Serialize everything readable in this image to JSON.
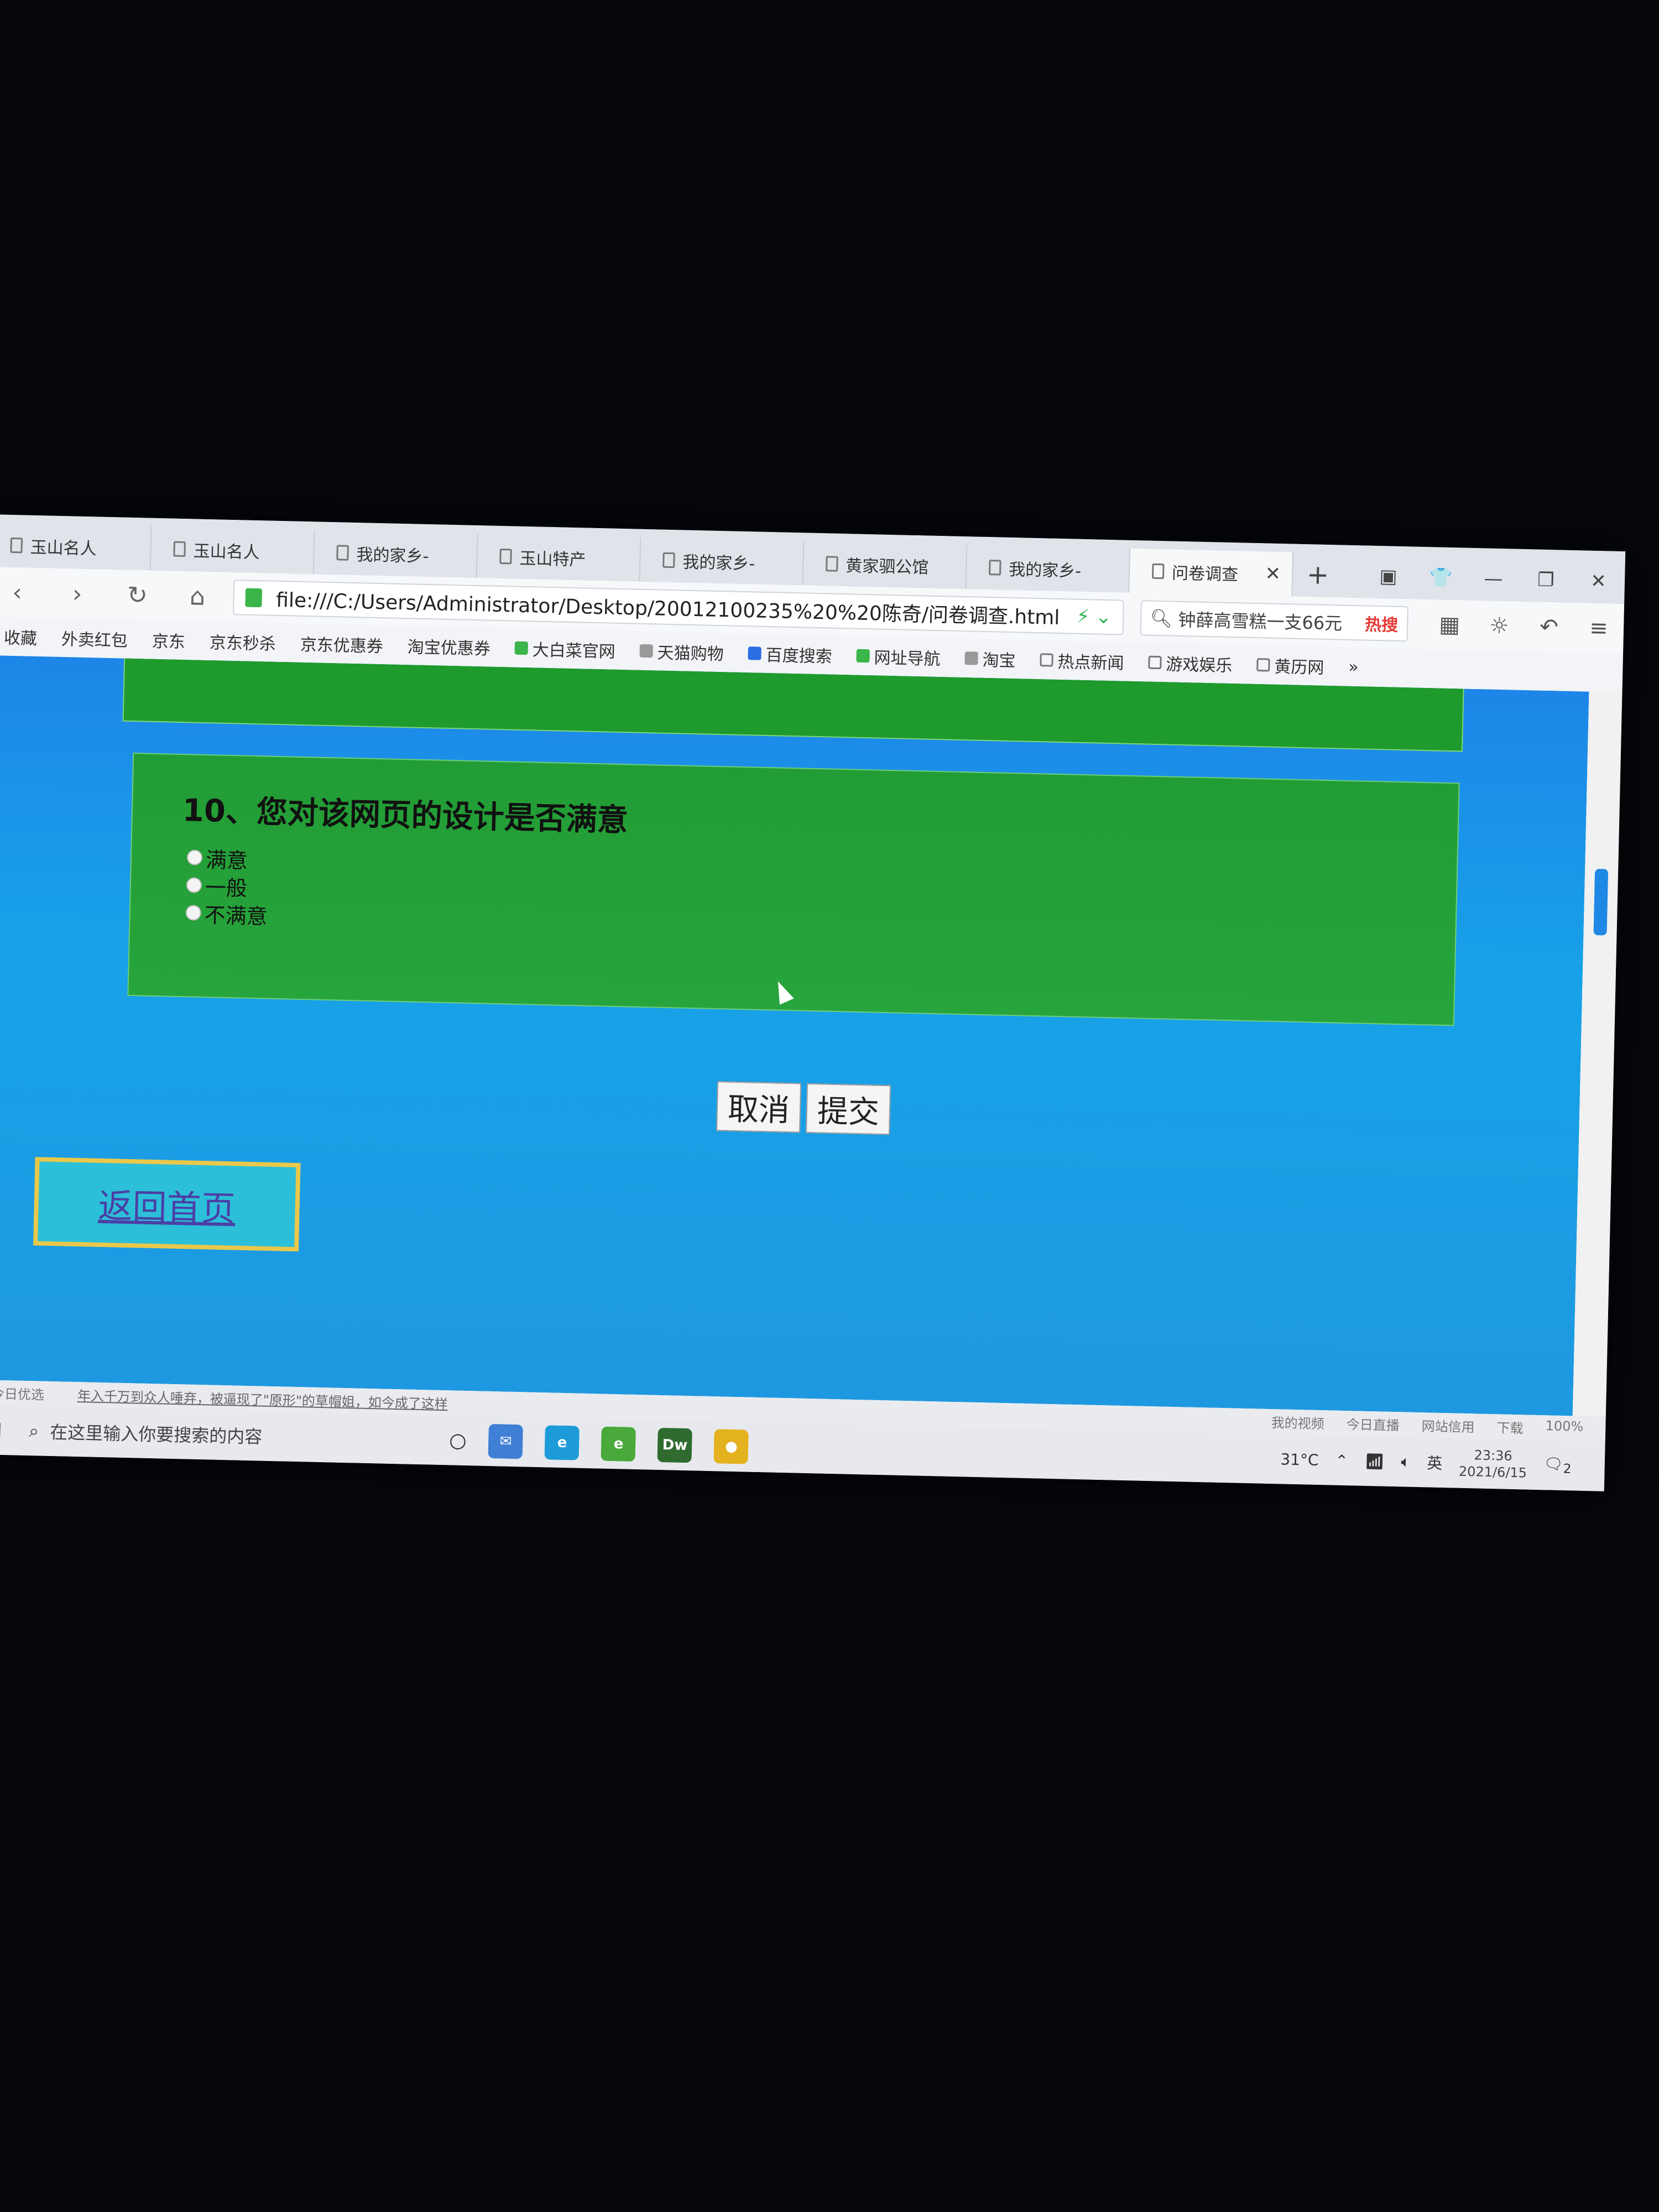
{
  "tabs": [
    {
      "label": "玉山名人"
    },
    {
      "label": "玉山名人"
    },
    {
      "label": "我的家乡-"
    },
    {
      "label": "玉山特产"
    },
    {
      "label": "我的家乡-"
    },
    {
      "label": "黄家驷公馆"
    },
    {
      "label": "我的家乡-"
    },
    {
      "label": "问卷调查",
      "active": true
    }
  ],
  "address": {
    "url": "file:///C:/Users/Administrator/Desktop/20012100235%20%20陈奇/问卷调查.html"
  },
  "search": {
    "text": "钟薛高雪糕一支66元",
    "hot_label": "热搜"
  },
  "bookmarks": [
    "收藏",
    "外卖红包",
    "京东",
    "京东秒杀",
    "京东优惠券",
    "淘宝优惠券",
    "大白菜官网",
    "天猫购物",
    "百度搜索",
    "网址导航",
    "淘宝",
    "热点新闻",
    "游戏娱乐",
    "黄历网",
    "»"
  ],
  "question": {
    "title": "10、您对该网页的设计是否满意",
    "options": [
      "满意",
      "一般",
      "不满意"
    ]
  },
  "buttons": {
    "cancel": "取消",
    "submit": "提交"
  },
  "home_link": "返回首页",
  "statusbar": {
    "left": "今日优选",
    "news": "年入千万到众人唾弃，被逼现了\"原形\"的草帽姐，如今成了这样",
    "items": [
      "我的视频",
      "今日直播",
      "网站信用",
      "下载",
      "100%"
    ]
  },
  "taskbar": {
    "search_placeholder": "在这里输入你要搜索的内容",
    "temperature": "31°C",
    "ime": "英",
    "time": "23:36",
    "date": "2021/6/15",
    "notifications": "2"
  },
  "colors": {
    "page_bg": "#1a96e6",
    "question_box": "#24a038",
    "home_border": "#e9c84a",
    "link": "#4b3fa6"
  }
}
